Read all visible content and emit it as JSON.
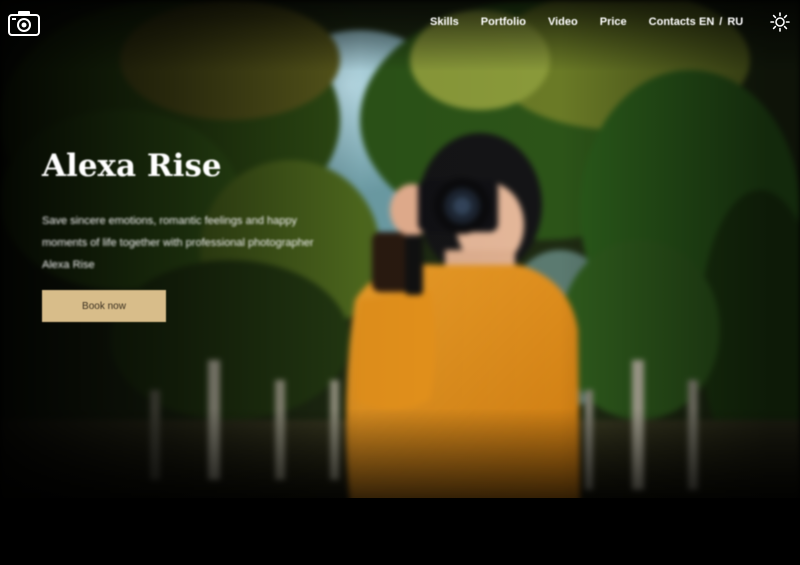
{
  "header": {
    "logo_icon": "camera-icon",
    "nav": [
      {
        "label": "Skills"
      },
      {
        "label": "Portfolio"
      },
      {
        "label": "Video"
      },
      {
        "label": "Price"
      },
      {
        "label": "Contacts"
      }
    ],
    "lang": {
      "en": "EN",
      "separator": "/",
      "ru": "RU"
    },
    "theme_icon": "sun-icon"
  },
  "hero": {
    "title": "Alexa Rise",
    "description": "Save sincere emotions, romantic feelings and happy moments of life together with professional photographer Alexa Rise",
    "cta_label": "Book now"
  },
  "colors": {
    "accent": "#d8bd8a",
    "background": "#000000",
    "text": "#ffffff"
  }
}
